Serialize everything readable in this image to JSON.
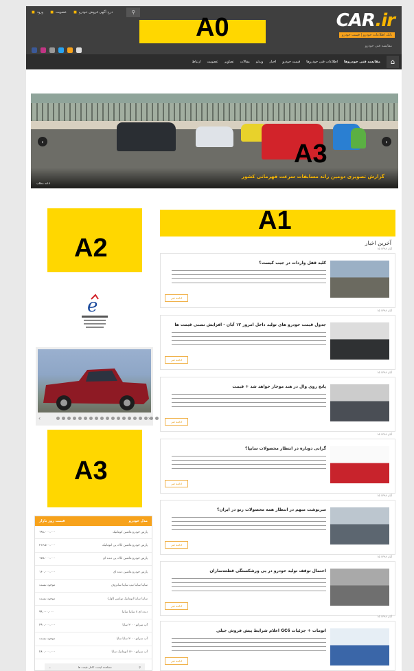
{
  "header": {
    "logo_main": "CAR",
    "logo_dot": ".ir",
    "tagline": "بانک اطلاعات خودرو | قیمت خودرو",
    "breadcrumb": "مقایسه فنی خودرو",
    "top_links": [
      "ورود",
      "عضویت",
      "درج آگهی فروش خودرو"
    ],
    "search_icon": "search-icon"
  },
  "nav": {
    "items": [
      "مقایسه فنی خودروها",
      "اطلاعات فنی خودروها",
      "قیمت خودرو",
      "اخبار",
      "ویدئو",
      "مقالات",
      "تصاویر",
      "عضویت",
      "ارتباط"
    ],
    "home_icon": "home-icon"
  },
  "ads": {
    "a0": "A0",
    "a1": "A1",
    "a2": "A2",
    "a3_slider": "A3",
    "a3_side": "A3"
  },
  "slider": {
    "caption": "گزارش تصویری دومین راند مسابقات سرعت قهرمانی کشور",
    "more": "ادامه مطلب"
  },
  "news_section_title": "آخرین اخبار",
  "news": [
    {
      "date": "۱۵ آبان ۱۳۹۸",
      "title": "کلید قفل واردات در جیب کیست؟",
      "more": "ادامه خبر"
    },
    {
      "date": "۱۵ آبان ۱۳۹۸",
      "title": "جدول قیمت خودرو های تولید داخل امروز ۱۳ آبان - افزایش نسبی قیمت ها",
      "more": "ادامه خبر"
    },
    {
      "date": "۱۵ آبان ۱۳۹۸",
      "title": "پانچ روی وال در هند موجاز خواهد شد + قیمت",
      "more": "ادامه خبر"
    },
    {
      "date": "۱۵ آبان ۱۳۹۸",
      "title": "گرانی دوباره در انتظار محصولات سایپا؟",
      "more": "ادامه خبر"
    },
    {
      "date": "۱۵ آبان ۱۳۹۸",
      "title": "سرنوشت مبهم در انتظار همه محصولات رنو در ایران؟",
      "more": "ادامه خبر"
    },
    {
      "date": "۱۵ آبان ۱۳۹۸",
      "title": "احتمال توقف تولید خودرو در پی ورشکستگی قطعه‌سازان",
      "more": "ادامه خبر"
    },
    {
      "date": "۱۵ آبان ۱۳۹۸",
      "title": "اعلام شرایط پیش فروش جیلی GC6 اتومات + جزئیات",
      "more": "ادامه خبر"
    }
  ],
  "prices": {
    "head_right": "مدل خودرو",
    "head_left": "قیمت روز بازار",
    "rows": [
      {
        "name": "پارس خودرو ماشین کوماتیک",
        "price": "۱۹۸،۰۰۰،۰۰۰"
      },
      {
        "name": "پارس خودرو ماشین اتاک پی اتوماتیک",
        "price": "۲۱۷،۵۰۰،۰۰۰"
      },
      {
        "name": "پارس خودرو ماشین اتاک پی دنده ای",
        "price": "۱۷۵،۰۰۰،۰۰۰"
      },
      {
        "name": "پارس خودرو ماشین دنده ای",
        "price": "۱۶۰،۰۰۰،۰۰۰"
      },
      {
        "name": "ساینا ساینا تیپ ساینا سانروف",
        "price": "موجود نیست"
      },
      {
        "name": "ساینا ساینا اتوماتیک توانس (اول)",
        "price": "موجود نیست"
      },
      {
        "name": "ساینا ساینا s دنده ای",
        "price": "۹۹،۰۰۰،۰۰۰"
      },
      {
        "name": "آپ سراتو ۲۰۰۰ ساپا",
        "price": "۲۹۰،۰۰۰،۰۰۰"
      },
      {
        "name": "آپ سراتو ۲۰۰۰ ساپا ساپا",
        "price": "موجود نیست"
      },
      {
        "name": "آپ سراتو ۱۶۰۰ اتوماتیک ساپا",
        "price": "۲۸۰،۰۰۰،۰۰۰"
      }
    ],
    "footer": "مشاهده لیست کامل قیمت ها"
  }
}
